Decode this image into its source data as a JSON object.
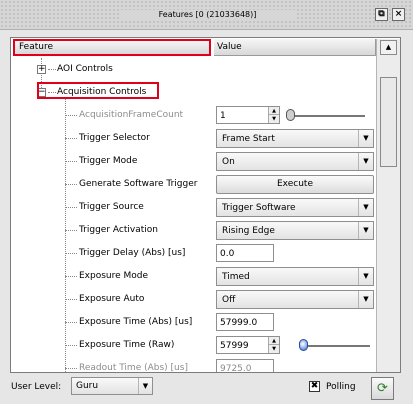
{
  "window": {
    "title": "Features [0 (21033648)]",
    "restore_icon": "restore-icon",
    "close_icon": "close-icon"
  },
  "table": {
    "headers": {
      "feature": "Feature",
      "value": "Value"
    },
    "categories": [
      {
        "label": "AOI Controls",
        "expanded": false
      },
      {
        "label": "Acquisition Controls",
        "expanded": true
      }
    ],
    "rows": [
      {
        "label": "AcquisitionFrameCount",
        "widget": "spin-slider",
        "value": "1",
        "disabled": true
      },
      {
        "label": "Trigger Selector",
        "widget": "combo",
        "value": "Frame Start"
      },
      {
        "label": "Trigger Mode",
        "widget": "combo",
        "value": "On"
      },
      {
        "label": "Generate Software Trigger",
        "widget": "button",
        "value": "Execute"
      },
      {
        "label": "Trigger Source",
        "widget": "combo",
        "value": "Trigger Software"
      },
      {
        "label": "Trigger Activation",
        "widget": "combo",
        "value": "Rising Edge"
      },
      {
        "label": "Trigger Delay (Abs) [us]",
        "widget": "field",
        "value": "0.0"
      },
      {
        "label": "Exposure Mode",
        "widget": "combo",
        "value": "Timed"
      },
      {
        "label": "Exposure Auto",
        "widget": "combo",
        "value": "Off"
      },
      {
        "label": "Exposure Time (Abs) [us]",
        "widget": "field",
        "value": "57999.0"
      },
      {
        "label": "Exposure Time (Raw)",
        "widget": "spin-slider",
        "value": "57999"
      },
      {
        "label": "Readout Time (Abs) [us]",
        "widget": "field",
        "value": "9725.0"
      }
    ]
  },
  "footer": {
    "user_level_label": "User Level:",
    "user_level_value": "Guru",
    "polling_label": "Polling",
    "polling_checked": true,
    "polling_mark": "✖",
    "refresh_icon": "refresh-icon"
  }
}
